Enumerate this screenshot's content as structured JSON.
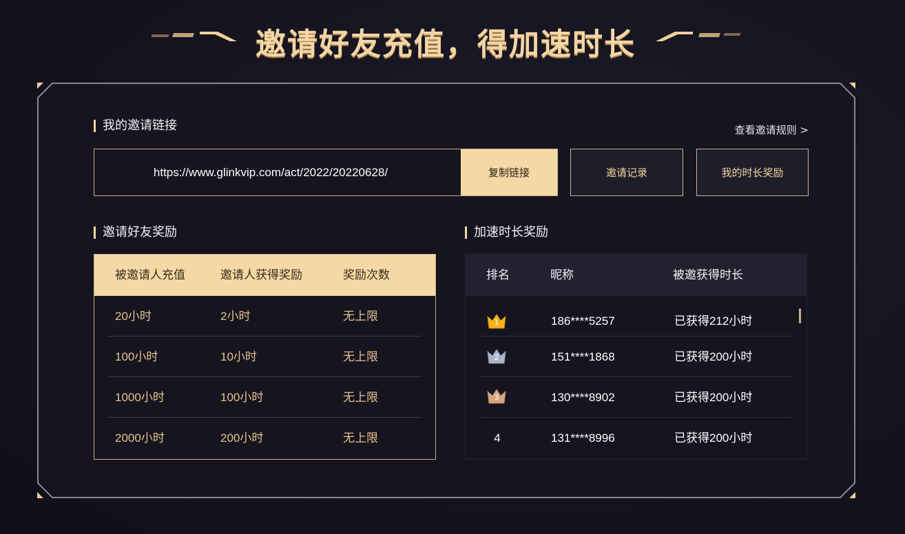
{
  "page": {
    "title": "邀请好友充值，得加速时长"
  },
  "invite_link": {
    "section_title": "我的邀请链接",
    "rules_link": "查看邀请规则 >",
    "url": "https://www.glinkvip.com/act/2022/20220628/",
    "copy_label": "复制链接",
    "records_label": "邀请记录",
    "rewards_label": "我的时长奖励"
  },
  "invite_rewards": {
    "section_title": "邀请好友奖励",
    "headers": [
      "被邀请人充值",
      "邀请人获得奖励",
      "奖励次数"
    ],
    "rows": [
      [
        "20小时",
        "2小时",
        "无上限"
      ],
      [
        "100小时",
        "10小时",
        "无上限"
      ],
      [
        "1000小时",
        "100小时",
        "无上限"
      ],
      [
        "2000小时",
        "200小时",
        "无上限"
      ]
    ]
  },
  "ranking": {
    "section_title": "加速时长奖励",
    "headers": [
      "排名",
      "昵称",
      "被邀获得时长"
    ],
    "rows": [
      {
        "rank": "1",
        "nickname": "186****5257",
        "duration": "已获得212小时",
        "crown": "gold-crown-icon",
        "crown_color": "#f2b21c"
      },
      {
        "rank": "2",
        "nickname": "151****1868",
        "duration": "已获得200小时",
        "crown": "silver-crown-icon",
        "crown_color": "#aab6c6"
      },
      {
        "rank": "3",
        "nickname": "130****8902",
        "duration": "已获得200小时",
        "crown": "bronze-crown-icon",
        "crown_color": "#d6a582"
      },
      {
        "rank": "4",
        "nickname": "131****8996",
        "duration": "已获得200小时"
      }
    ]
  },
  "colors": {
    "accent": "#f4d8a5",
    "gold_text": "#e6c48e",
    "background": "#15141f"
  }
}
